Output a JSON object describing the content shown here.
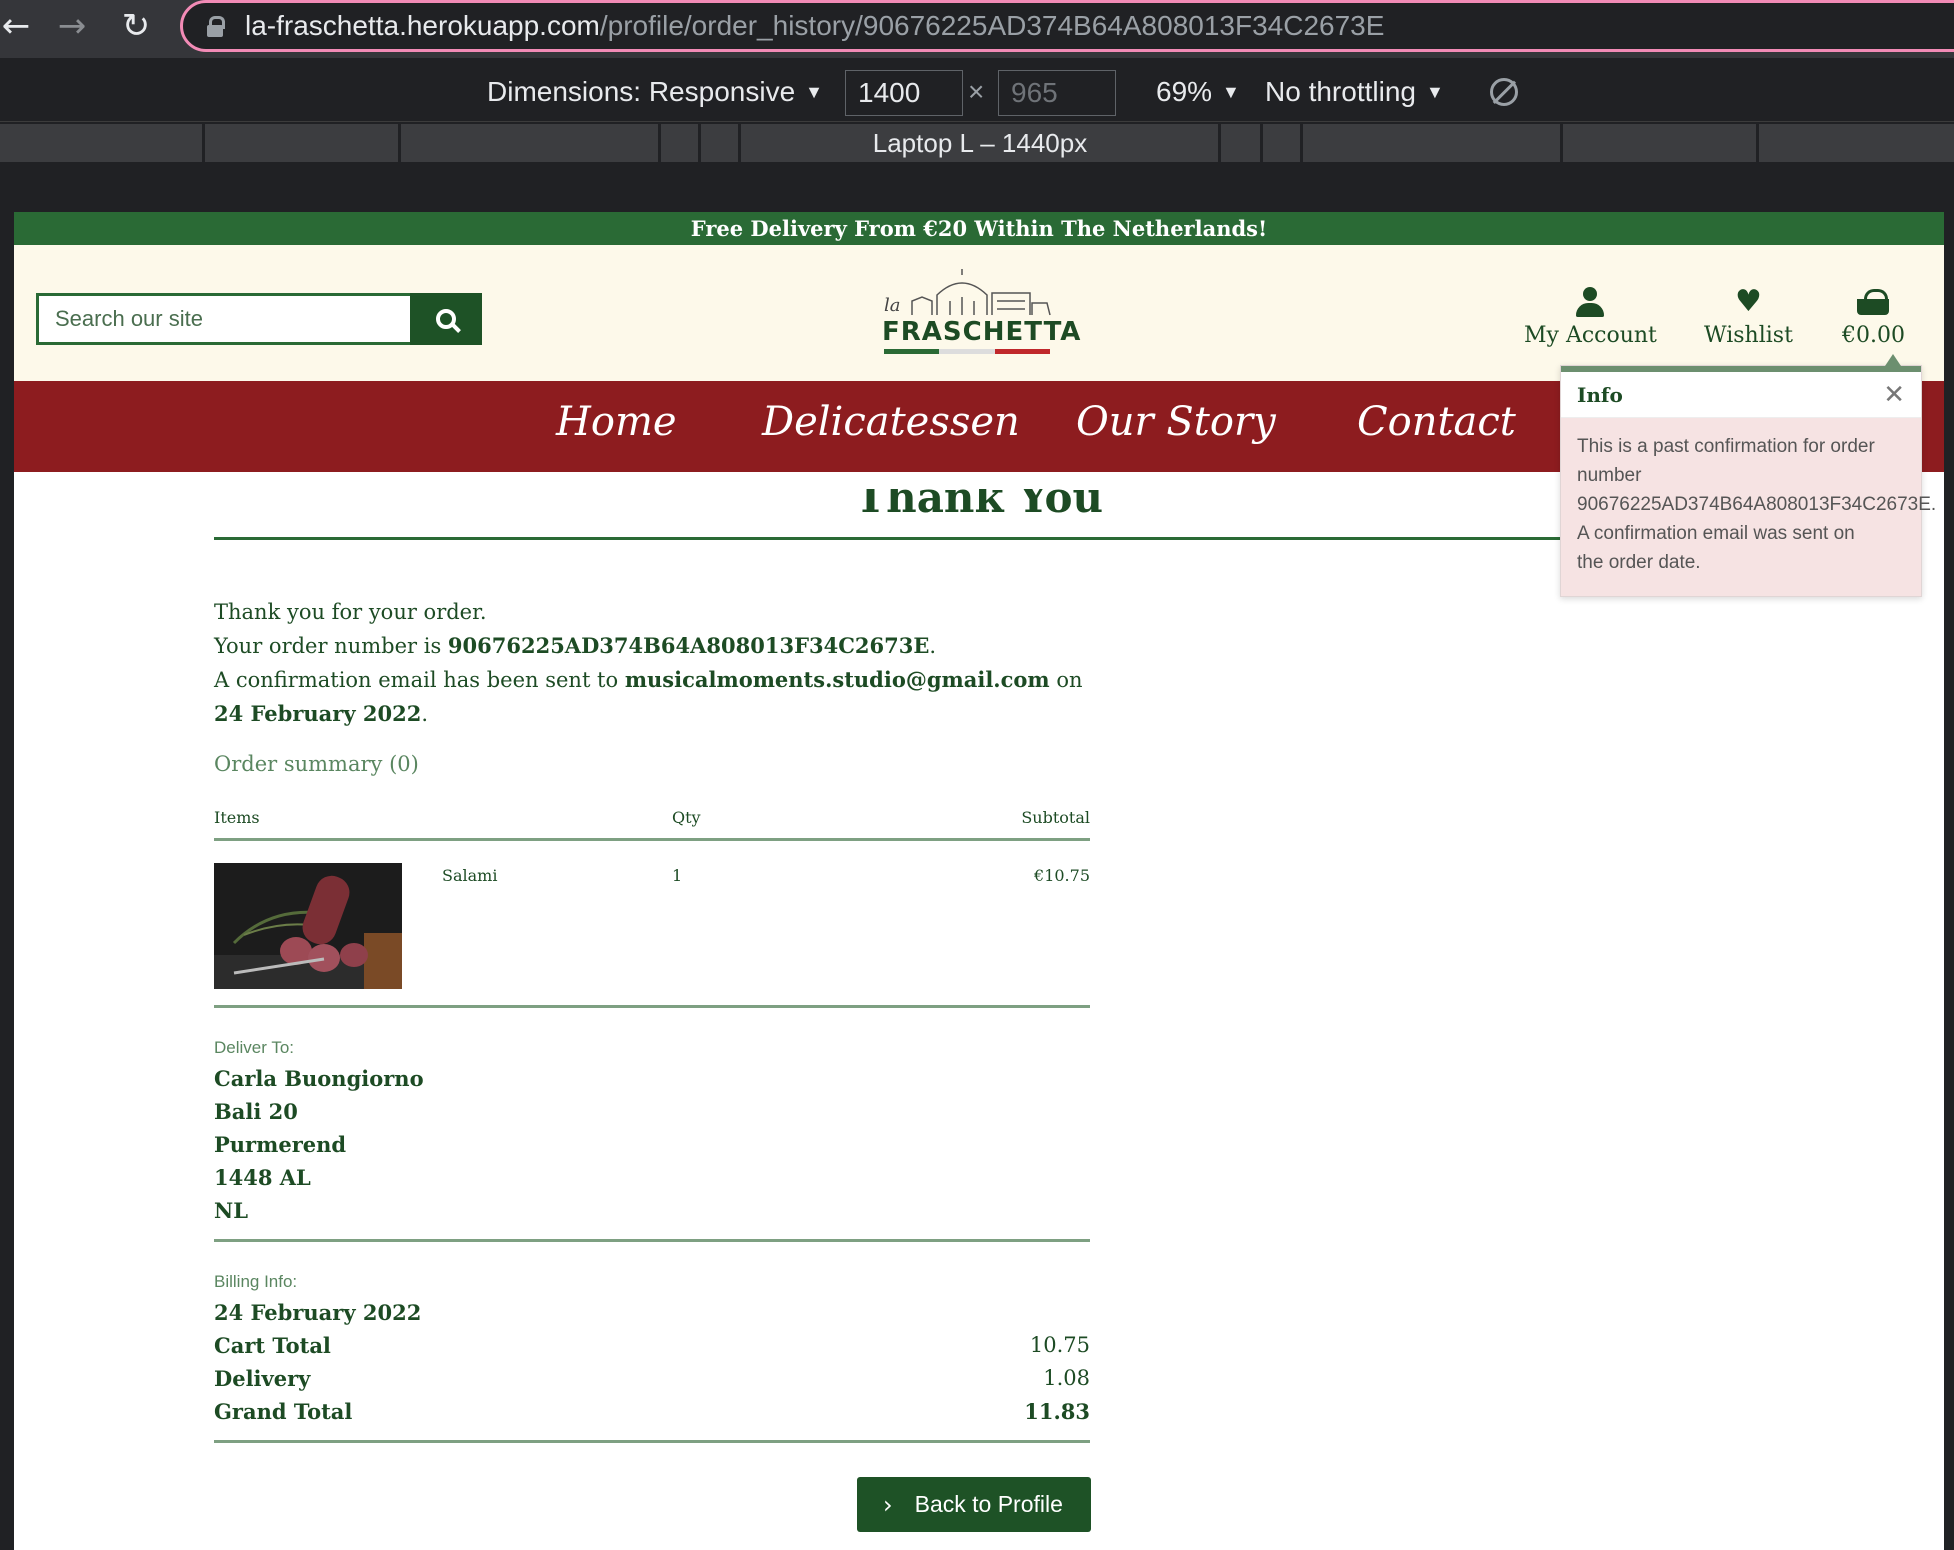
{
  "browser": {
    "url_host": "la-fraschetta.herokuapp.com",
    "url_path": "/profile/order_history/90676225AD374B64A808013F34C2673E"
  },
  "devtools": {
    "dimensions_label": "Dimensions: Responsive",
    "width": "1400",
    "height": "965",
    "times": "×",
    "zoom": "69%",
    "throttling": "No throttling",
    "breakpoint_label": "Laptop L – 1440px"
  },
  "site": {
    "promo": "Free Delivery From €20 Within The Netherlands!",
    "search_placeholder": "Search our site",
    "logo_la": "la",
    "logo_name": "FRASCHETTA",
    "account_label": "My Account",
    "wishlist_label": "Wishlist",
    "cart_total": "€0.00",
    "nav": [
      "Home",
      "Delicatessen",
      "Our Story",
      "Contact"
    ],
    "colors": {
      "green": "#1d4b24",
      "red": "#8d1c1f",
      "cream": "#fdf9ea"
    }
  },
  "order": {
    "heading": "Thank You",
    "thanks": "Thank you for your order.",
    "order_number_prefix": "Your order number is ",
    "order_number": "90676225AD374B64A808013F34C2673E",
    "email_prefix": "A confirmation email has been sent to ",
    "email": "musicalmoments.studio@gmail.com",
    "on": " on ",
    "date": "24 February 2022",
    "summary_title": "Order summary (0)",
    "col_items": "Items",
    "col_qty": "Qty",
    "col_subtotal": "Subtotal",
    "item_name": "Salami",
    "item_qty": "1",
    "item_subtotal": "€10.75",
    "deliver_to_label": "Deliver To:",
    "address": [
      "Carla Buongiorno",
      "Bali 20",
      "Purmerend",
      "1448 AL",
      "NL"
    ],
    "billing_label": "Billing Info:",
    "billing_date": "24 February 2022",
    "cart_total_label": "Cart Total",
    "cart_total_value": "10.75",
    "delivery_label": "Delivery",
    "delivery_value": "1.08",
    "grand_total_label": "Grand Total",
    "grand_total_value": "11.83",
    "back_button": "Back to Profile"
  },
  "toast": {
    "title": "Info",
    "lines": [
      "This is a past confirmation for order",
      "number",
      "90676225AD374B64A808013F34C2673E.",
      "A confirmation email was sent on",
      "the order date."
    ]
  }
}
